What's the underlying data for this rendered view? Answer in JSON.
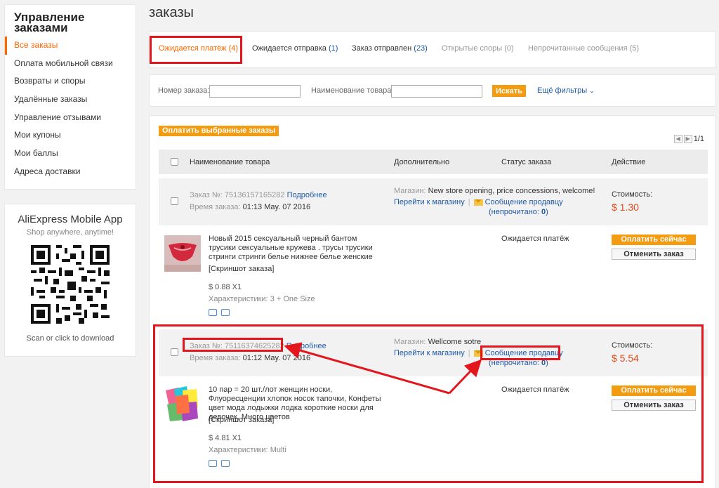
{
  "sidebar": {
    "title_line1": "Управление",
    "title_line2": "заказами",
    "items": [
      {
        "label": "Все заказы"
      },
      {
        "label": "Оплата мобильной связи"
      },
      {
        "label": "Возвраты и споры"
      },
      {
        "label": "Удалённые заказы"
      },
      {
        "label": "Управление отзывами"
      },
      {
        "label": "Мои купоны"
      },
      {
        "label": "Мои баллы"
      },
      {
        "label": "Адреса доставки"
      }
    ]
  },
  "app": {
    "title": "AliExpress Mobile App",
    "subtitle": "Shop anywhere, anytime!",
    "download": "Scan or click to download"
  },
  "page": {
    "title": "заказы"
  },
  "tabs": [
    {
      "label": "Ожидается платёж",
      "count": "(4)"
    },
    {
      "label": "Ожидается отправка",
      "count": "(1)"
    },
    {
      "label": "Заказ отправлен",
      "count": "(23)"
    },
    {
      "label": "Открытые споры",
      "count": "(0)"
    },
    {
      "label": "Непрочитанные сообщения",
      "count": "(5)"
    }
  ],
  "filters": {
    "order_number_label": "Номер заказа:",
    "order_number_value": "",
    "product_name_label": "Наименование товара:",
    "product_name_value": "",
    "search_label": "Искать",
    "more_filters": "Ещё фильтры"
  },
  "list": {
    "pay_selected": "Оплатить выбранные заказы",
    "pager": "1/1",
    "columns": {
      "product": "Наименование товара",
      "extra": "Дополнительно",
      "status": "Статус заказа",
      "action": "Действие"
    }
  },
  "common": {
    "order_label": "Заказ №:",
    "details": "Подробнее",
    "time_label": "Время заказа:",
    "store_label": "Магазин:",
    "go_to_store": "Перейти к магазину",
    "message_seller": "Сообщение продавцу",
    "unread_prefix": "(непрочитано:",
    "unread_suffix": ")",
    "cost_label": "Стоимость:",
    "screenshot": "[Скриншот заказа]",
    "chars_label": "Характеристики:",
    "pay_now": "Оплатить сейчас",
    "cancel_order": "Отменить заказ"
  },
  "orders": [
    {
      "number": "75136157165282",
      "time": "01:13 May. 07 2016",
      "store": "New store opening, price concessions, welcome!",
      "unread": "0",
      "cost": "$ 1.30",
      "product_title": "Новый 2015 сексуальный черный бантом трусики сексуальные кружева . трусы трусики стринги стринги белье нижнее белье женские",
      "price": "$ 0.88 X1",
      "chars": "3 + One Size",
      "status": "Ожидается платёж"
    },
    {
      "number": "75116374625282",
      "time": "01:12 May. 07 2016",
      "store": "Wellcome sotre",
      "unread": "0",
      "cost": "$ 5.54",
      "product_title": "10 пар = 20 шт./лот женщин носки, Флуоресценции хлопок носок тапочки, Конфеты цвет мода лодыжки лодка короткие носки для девочек, Много цветов",
      "price": "$ 4.81 X1",
      "chars": "Multi",
      "status": "Ожидается платёж"
    }
  ],
  "colors": {
    "accent": "#ff6600",
    "button": "#f39c12",
    "annotation": "#e3161e",
    "link": "#1e5aa8",
    "price": "#e64a19"
  }
}
